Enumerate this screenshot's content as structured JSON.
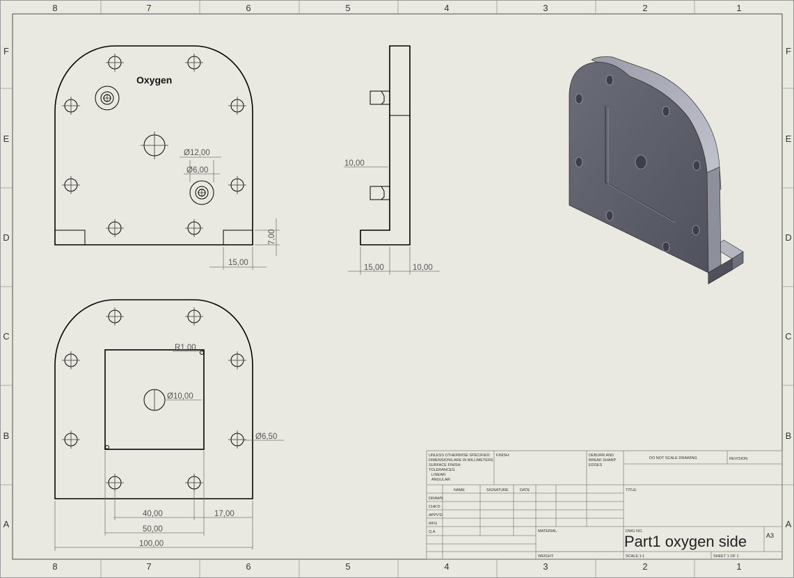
{
  "border": {
    "columns": [
      "8",
      "7",
      "6",
      "5",
      "4",
      "3",
      "2",
      "1"
    ],
    "rows": [
      "F",
      "E",
      "D",
      "C",
      "B",
      "A"
    ]
  },
  "front_view": {
    "label": "Oxygen",
    "dims": {
      "hole_large": "Ø12,00",
      "hole_small": "Ø6,00",
      "foot_height": "7,00",
      "foot_width": "15,00"
    }
  },
  "side_view": {
    "dims": {
      "boss_height": "10,00",
      "foot_length": "15,00",
      "plate_thickness": "10,00"
    }
  },
  "bottom_view": {
    "dims": {
      "fillet": "R1,00",
      "center_hole": "Ø10,00",
      "bolt_hole": "Ø6,50",
      "hole_spacing": "40,00",
      "hole_edge": "17,00",
      "pocket_width": "50,00",
      "overall_width": "100,00"
    }
  },
  "title_block": {
    "notes": [
      "UNLESS OTHERWISE SPECIFIED:",
      "DIMENSIONS ARE IN MILLIMETERS",
      "SURFACE FINISH:",
      "TOLERANCES:",
      "LINEAR:",
      "ANGULAR:"
    ],
    "finish": "FINISH:",
    "deburr": [
      "DEBURR AND",
      "BREAK SHARP",
      "EDGES"
    ],
    "do_not_scale": "DO NOT SCALE DRAWING",
    "revision": "REVISION",
    "headers": [
      "NAME",
      "SIGNATURE",
      "DATE"
    ],
    "roles": [
      "DRAWN",
      "CHK'D",
      "APPV'D",
      "MFG",
      "Q.A"
    ],
    "title_label": "TITLE:",
    "material": "MATERIAL:",
    "dwg_no": "DWG NO.",
    "part_name": "Part1 oxygen side",
    "sheet_size": "A3",
    "weight": "WEIGHT:",
    "scale": "SCALE:1:1",
    "sheet": "SHEET 1 OF 1"
  }
}
